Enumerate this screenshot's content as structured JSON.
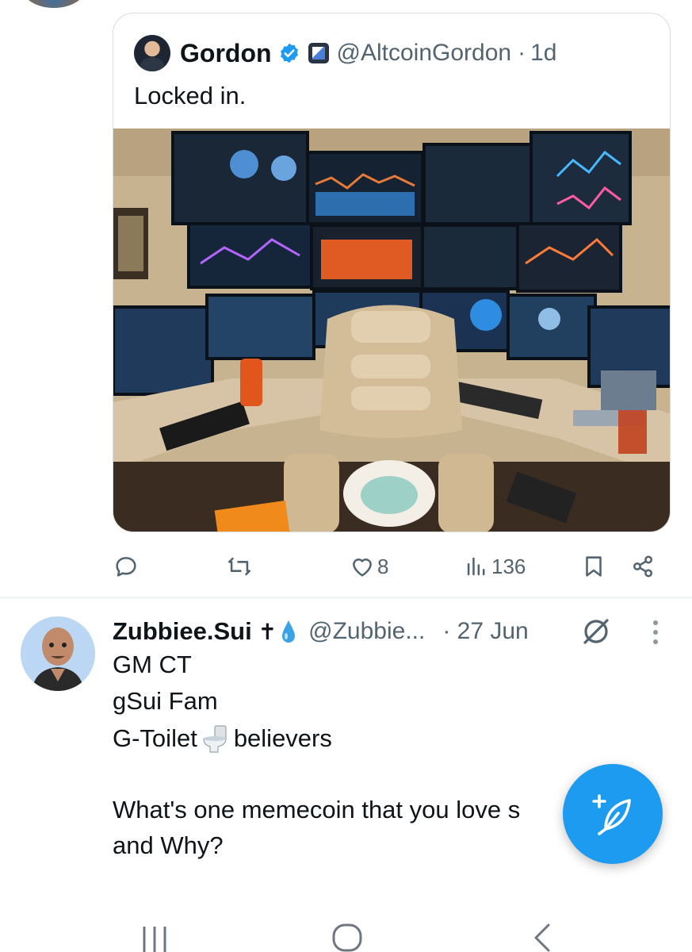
{
  "quoted_tweet": {
    "author_name": "Gordon",
    "handle": "@AltcoinGordon",
    "separator": "·",
    "time": "1d",
    "text": "Locked in."
  },
  "actions": {
    "reply_count": "",
    "retweet_count": "",
    "like_count": "8",
    "view_count": "136"
  },
  "tweet": {
    "author_name": "Zubbiee.Sui",
    "name_emoji": "✝",
    "handle": "@Zubbie...",
    "date": "· 27 Jun",
    "lines": [
      "GM CT",
      "gSui Fam",
      "G-Toilet",
      "believers",
      "What's one memecoin that you love s",
      "and Why?"
    ]
  },
  "colors": {
    "accent": "#1d9bf0",
    "text_primary": "#0f1419",
    "text_secondary": "#536471",
    "border": "#d8dde1"
  },
  "icons": {
    "reply": "reply-icon",
    "retweet": "retweet-icon",
    "like": "heart-icon",
    "views": "views-icon",
    "bookmark": "bookmark-icon",
    "share": "share-icon",
    "compose": "compose-icon",
    "grok": "grok-icon",
    "more": "more-icon"
  }
}
